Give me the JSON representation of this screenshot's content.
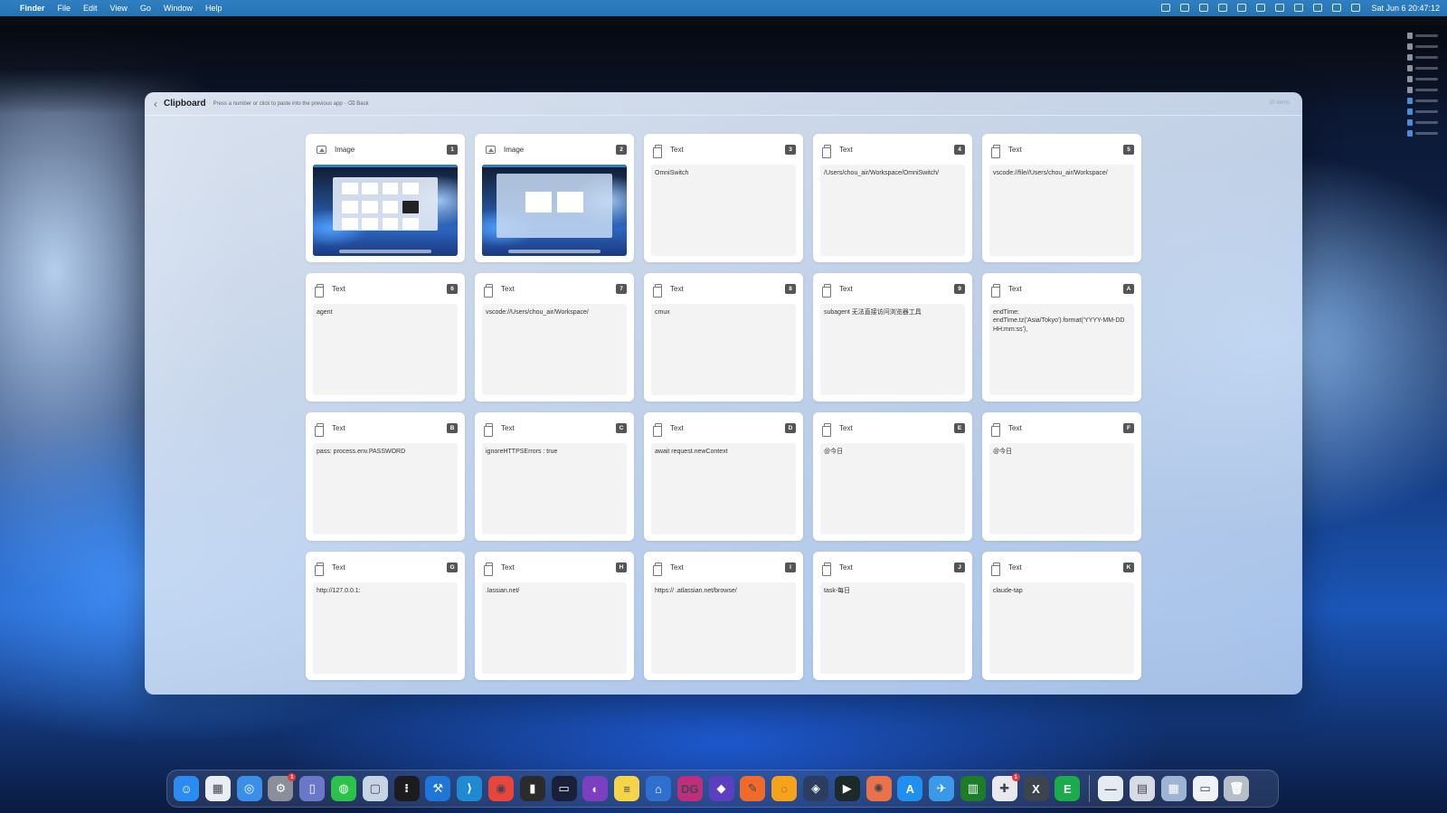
{
  "menubar": {
    "app_name": "Finder",
    "menus": [
      "File",
      "Edit",
      "View",
      "Go",
      "Window",
      "Help"
    ],
    "clock": "Sat Jun 6  20:47:12",
    "status_icons": [
      "cloud-icon",
      "sparkle-icon",
      "grid-icon",
      "monitor-icon",
      "person-icon",
      "bell-icon",
      "clipboard-icon",
      "search-icon",
      "input-method-icon",
      "window-icon",
      "control-center-icon"
    ]
  },
  "clipboard": {
    "title": "Clipboard",
    "hint": "Press a number or click to paste into the previous app · ⌫ Back",
    "count": "20 items",
    "items": [
      {
        "type": "Image",
        "key": "1",
        "content": "",
        "icon": "image-icon"
      },
      {
        "type": "Image",
        "key": "2",
        "content": "",
        "icon": "image-icon"
      },
      {
        "type": "Text",
        "key": "3",
        "content": "OmniSwitch",
        "icon": "document-icon"
      },
      {
        "type": "Text",
        "key": "4",
        "content": "/Users/chou_air/Workspace/OmniSwitch/",
        "icon": "document-icon"
      },
      {
        "type": "Text",
        "key": "5",
        "content": "vscode://file//Users/chou_air/Workspace/",
        "icon": "document-icon"
      },
      {
        "type": "Text",
        "key": "6",
        "content": "agent",
        "icon": "document-icon"
      },
      {
        "type": "Text",
        "key": "7",
        "content": "vscode://Users/chou_air/Workspace/",
        "icon": "document-icon"
      },
      {
        "type": "Text",
        "key": "8",
        "content": "cmux",
        "icon": "document-icon"
      },
      {
        "type": "Text",
        "key": "9",
        "content": "subagent 无法直接访问浏览器工具",
        "icon": "document-icon"
      },
      {
        "type": "Text",
        "key": "A",
        "content": "endTime: endTime.tz('Asia/Tokyo').format('YYYY-MM-DD HH:mm:ss'),",
        "icon": "document-icon"
      },
      {
        "type": "Text",
        "key": "B",
        "content": "pass: process.env.PASSWORD",
        "icon": "document-icon"
      },
      {
        "type": "Text",
        "key": "C",
        "content": "ignoreHTTPSErrors : true",
        "icon": "document-icon"
      },
      {
        "type": "Text",
        "key": "D",
        "content": "await request.newContext",
        "icon": "document-icon"
      },
      {
        "type": "Text",
        "key": "E",
        "content": "@今日",
        "icon": "document-icon"
      },
      {
        "type": "Text",
        "key": "F",
        "content": "@今日",
        "icon": "document-icon"
      },
      {
        "type": "Text",
        "key": "G",
        "content": "http://127.0.0.1:",
        "icon": "document-icon"
      },
      {
        "type": "Text",
        "key": "H",
        "content": ".lassian.net/",
        "icon": "document-icon"
      },
      {
        "type": "Text",
        "key": "I",
        "content": "https://  .atlassian.net/browse/",
        "icon": "document-icon"
      },
      {
        "type": "Text",
        "key": "J",
        "content": "task-每日",
        "icon": "document-icon"
      },
      {
        "type": "Text",
        "key": "K",
        "content": "claude-tap",
        "icon": "document-icon"
      }
    ]
  },
  "dock": {
    "apps": [
      {
        "name": "finder-icon",
        "color": "#2a8cf0",
        "glyph": "☺"
      },
      {
        "name": "launchpad-icon",
        "color": "#e9eef5",
        "glyph": "▦"
      },
      {
        "name": "safari-icon",
        "color": "#3b8fe8",
        "glyph": "◎"
      },
      {
        "name": "system-settings-icon",
        "color": "#8a8f99",
        "glyph": "⚙",
        "badge": "1"
      },
      {
        "name": "simulator-icon",
        "color": "#6b78c8",
        "glyph": "▯"
      },
      {
        "name": "wechat-icon",
        "color": "#2bc24a",
        "glyph": "◍"
      },
      {
        "name": "preview-icon",
        "color": "#c8d4e4",
        "glyph": "▢"
      },
      {
        "name": "app-grid-icon",
        "color": "#1c1c1e",
        "glyph": "⁝"
      },
      {
        "name": "xcode-icon",
        "color": "#1e76d8",
        "glyph": "⚒"
      },
      {
        "name": "vscode-icon",
        "color": "#1f8ad2",
        "glyph": "⟩"
      },
      {
        "name": "chrome-icon",
        "color": "#e8453c",
        "glyph": "◉"
      },
      {
        "name": "terminal-app-icon",
        "color": "#2b2b2b",
        "glyph": "▮"
      },
      {
        "name": "terminal-icon",
        "color": "#1a1f3a",
        "glyph": "▭"
      },
      {
        "name": "github-desktop-icon",
        "color": "#7c3fbf",
        "glyph": "◐"
      },
      {
        "name": "notes-icon",
        "color": "#f5d44a",
        "glyph": "≡"
      },
      {
        "name": "tableplus-icon",
        "color": "#2f6fd0",
        "glyph": "⌂"
      },
      {
        "name": "datagrip-icon",
        "color": "#c02d7a",
        "glyph": "DG"
      },
      {
        "name": "obsidian-icon",
        "color": "#5b3fc0",
        "glyph": "◆"
      },
      {
        "name": "pen-app-icon",
        "color": "#f06a2a",
        "glyph": "✎"
      },
      {
        "name": "orange-app-icon",
        "color": "#f7a21b",
        "glyph": "◌"
      },
      {
        "name": "layers-app-icon",
        "color": "#2b3e60",
        "glyph": "◈"
      },
      {
        "name": "cursor-icon",
        "color": "#1c2a2a",
        "glyph": "▶"
      },
      {
        "name": "claude-icon",
        "color": "#e8734a",
        "glyph": "✺"
      },
      {
        "name": "app-store-icon",
        "color": "#1f8ff0",
        "glyph": "A"
      },
      {
        "name": "testflight-icon",
        "color": "#3a9ae8",
        "glyph": "✈"
      },
      {
        "name": "activity-monitor-icon",
        "color": "#1c7c2a",
        "glyph": "▥"
      },
      {
        "name": "slack-icon",
        "color": "#e8e8ee",
        "glyph": "✚",
        "badge": "1"
      },
      {
        "name": "xcode-instruments-icon",
        "color": "#3d4450",
        "glyph": "X"
      },
      {
        "name": "evernote-icon",
        "color": "#1cab4a",
        "glyph": "E"
      }
    ],
    "extras": [
      {
        "name": "minimized-window-icon",
        "color": "#e6ebf3",
        "glyph": "—"
      },
      {
        "name": "documents-stack-icon",
        "color": "#d7dce4",
        "glyph": "▤"
      },
      {
        "name": "screenshot-stack-icon",
        "color": "#9fb4d4",
        "glyph": "▦"
      },
      {
        "name": "downloads-stack-icon",
        "color": "#eef1f6",
        "glyph": "▭"
      },
      {
        "name": "trash-icon",
        "color": "#b8bec8",
        "glyph": "🗑"
      }
    ]
  }
}
